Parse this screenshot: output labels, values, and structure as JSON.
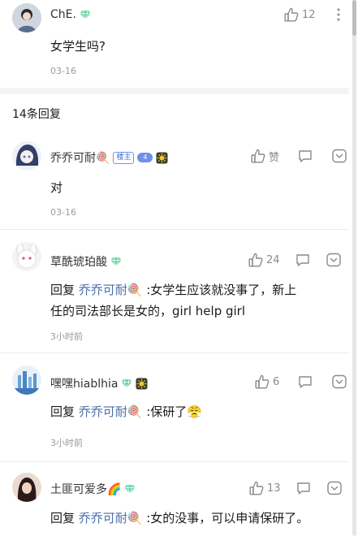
{
  "main_comment": {
    "username": "ChE.",
    "like_count": "12",
    "content": "女学生吗?",
    "time": "03-16"
  },
  "replies_header": "14条回复",
  "replies": [
    {
      "username": "乔乔可耐🍭",
      "tag": "楼主",
      "level": "4",
      "like_label": "赞",
      "content": "对",
      "time": "03-16"
    },
    {
      "username": "草酰琥珀酸",
      "like_count": "24",
      "reply_prefix": "回复",
      "mention": "乔乔可耐🍭",
      "content_line1": " :女学生应该就没事了，新上",
      "content_line2": "任的司法部长是女的，girl help girl",
      "time": "3小时前"
    },
    {
      "username": "嘿嘿hiablhia",
      "like_count": "6",
      "reply_prefix": "回复",
      "mention": "乔乔可耐🍭",
      "content": " :保研了😤",
      "time": "3小时前"
    },
    {
      "username": "土匪可爱多🌈",
      "like_count": "13",
      "reply_prefix": "回复",
      "mention": "乔乔可耐🍭",
      "content": " :女的没事，可以申请保研了。"
    }
  ],
  "colors": {
    "mention": "#4a6ea9",
    "meta_gray": "#9a9a9a",
    "diamond": "#6fd3a4",
    "host_tag": "#3b6fd6"
  },
  "icons": [
    "like-icon",
    "dislike-icon",
    "reply-icon",
    "more-icon",
    "vip-diamond-icon",
    "sun-badge-icon"
  ]
}
